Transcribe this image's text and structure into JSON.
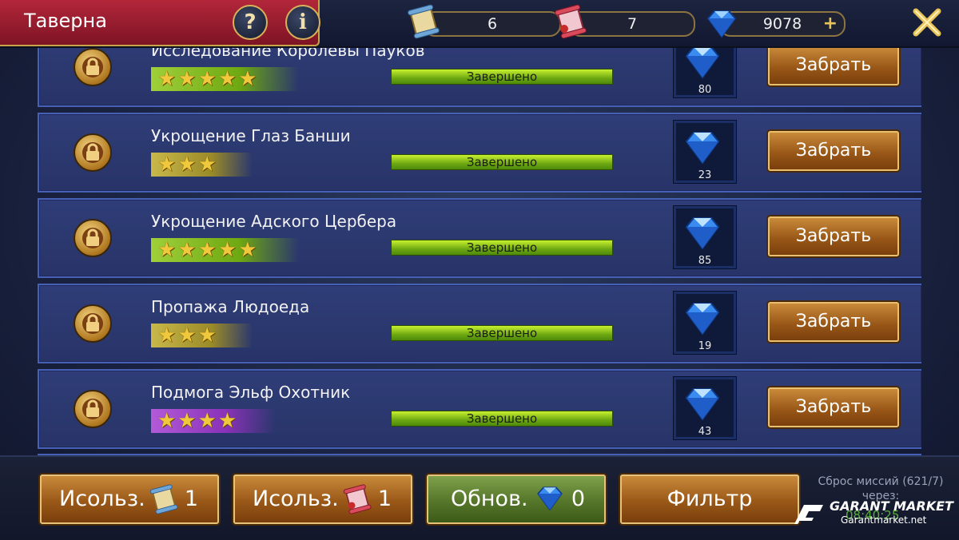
{
  "header": {
    "title": "Таверна",
    "help_label": "?",
    "info_label": "i",
    "resources": [
      {
        "icon": "scroll-icon",
        "value": "6"
      },
      {
        "icon": "red-scroll-icon",
        "value": "7"
      },
      {
        "icon": "diamond-icon",
        "value": "9078"
      }
    ],
    "add_label": "+",
    "close_icon": "close-icon"
  },
  "missions": [
    {
      "name": "Исследование Королевы Пауков",
      "stars": "★★★★★",
      "rarity": "green",
      "status": "Завершено",
      "reward": "80",
      "button": "Забрать"
    },
    {
      "name": "Укрощение Глаз Банши",
      "stars": "★★★",
      "rarity": "yellow",
      "status": "Завершено",
      "reward": "23",
      "button": "Забрать"
    },
    {
      "name": "Укрощение Адского Цербера",
      "stars": "★★★★★",
      "rarity": "green",
      "status": "Завершено",
      "reward": "85",
      "button": "Забрать"
    },
    {
      "name": "Пропажа Людоеда",
      "stars": "★★★",
      "rarity": "yellow",
      "status": "Завершено",
      "reward": "19",
      "button": "Забрать"
    },
    {
      "name": "Подмога Эльф Охотник",
      "stars": "★★★★",
      "rarity": "purple",
      "status": "Завершено",
      "reward": "43",
      "button": "Забрать"
    }
  ],
  "footer": {
    "use_scroll": {
      "label": "Исольз.",
      "count": "1"
    },
    "use_red_scroll": {
      "label": "Исольз.",
      "count": "1"
    },
    "refresh": {
      "label": "Обнов.",
      "count": "0"
    },
    "filter": {
      "label": "Фильтр"
    },
    "reset_text": "Сброс миссий (621/7) через:",
    "reset_timer": "08:40:25"
  },
  "watermark": {
    "brand": "GARANT MARKET",
    "site": "Garantmarket.net"
  },
  "colors": {
    "accent_red": "#b3263a",
    "gold": "#d7b25a",
    "progress_green": "#6ea812"
  }
}
